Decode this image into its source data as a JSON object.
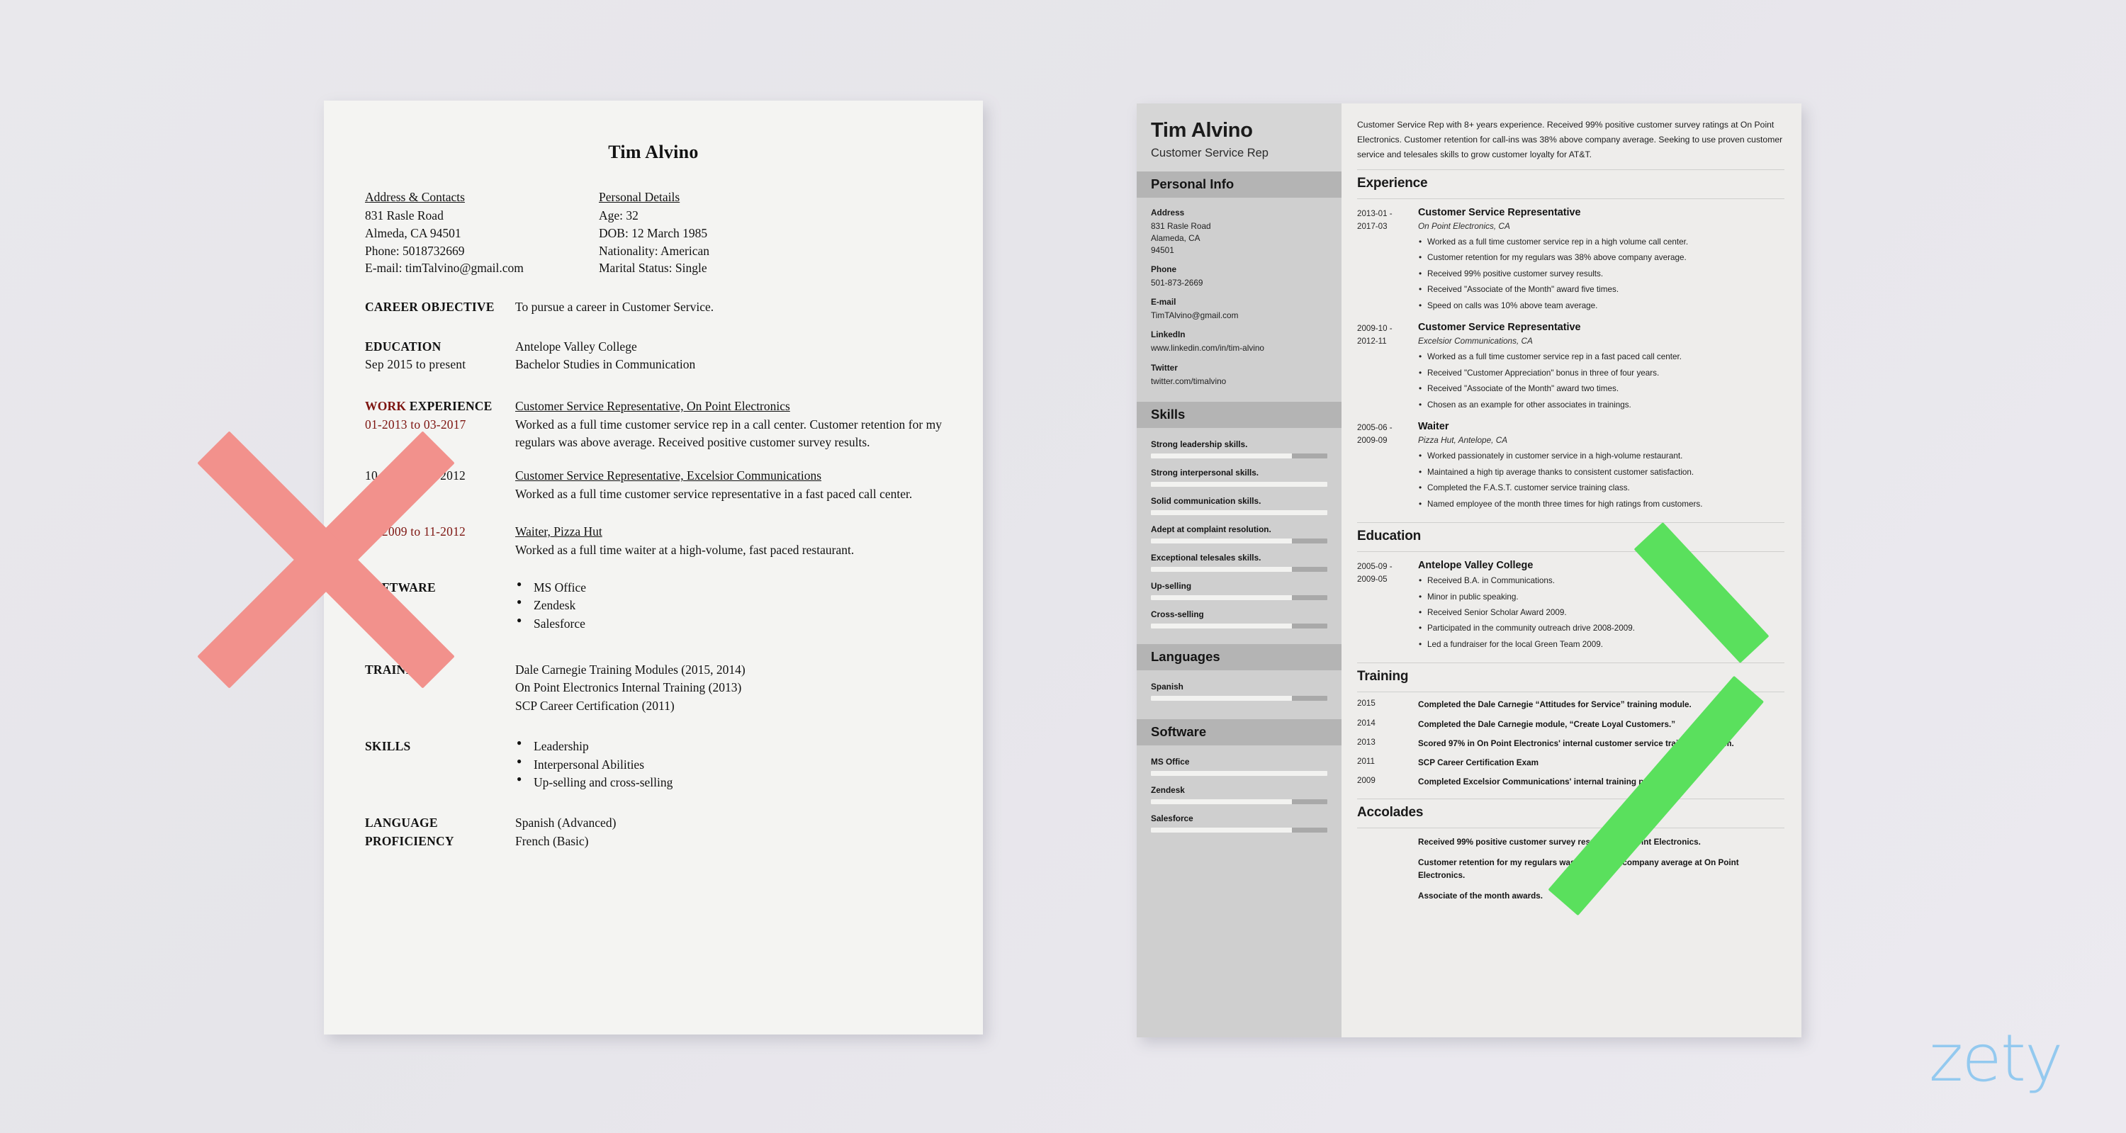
{
  "background_color": "#e8e7ec",
  "bad_resume": {
    "name": "Tim Alvino",
    "contacts": {
      "heading": "Address & Contacts",
      "line1": "831 Rasle Road",
      "line2": "Almeda, CA 94501",
      "line3": "Phone: 5018732669",
      "line4": "E-mail: timTalvino@gmail.com"
    },
    "personal": {
      "heading": "Personal Details",
      "line1": "Age:    32",
      "line2": "DOB:   12 March 1985",
      "line3": "Nationality: American",
      "line4": "Marital Status: Single"
    },
    "career_objective": {
      "label": "CAREER OBJECTIVE",
      "text": "To pursue a career in Customer Service."
    },
    "education": {
      "label": "EDUCATION",
      "sub": "Sep 2015 to present",
      "line1": "Antelope Valley College",
      "line2": "Bachelor Studies in Communication"
    },
    "work_experience": {
      "label_red": "WORK",
      "label_rest": " EXPERIENCE",
      "jobs": [
        {
          "dates": "01-2013 to 03-2017",
          "title": "Customer Service Representative, On Point Electronics",
          "desc": "Worked as a full time customer service rep in a call center. Customer retention for my regulars was above average. Received positive customer survey results."
        },
        {
          "dates": "10-2009 to 11-2012",
          "title": "Customer Service Representative, Excelsior Communications",
          "desc": "Worked as a full time customer service representative in a fast paced call center."
        },
        {
          "dates": "10-2009 to 11-2012",
          "title": "Waiter, Pizza Hut",
          "desc": "Worked as a full time waiter at a high-volume, fast paced restaurant."
        }
      ]
    },
    "software": {
      "label": "SOFTWARE",
      "items": [
        "MS Office",
        "Zendesk",
        "Salesforce"
      ]
    },
    "training": {
      "label": "TRAINING",
      "lines": [
        "Dale Carnegie Training Modules (2015, 2014)",
        "On Point Electronics Internal Training (2013)",
        "SCP Career Certification (2011)"
      ]
    },
    "skills": {
      "label": "SKILLS",
      "items": [
        "Leadership",
        "Interpersonal Abilities",
        "Up-selling and cross-selling"
      ]
    },
    "language": {
      "label_l1": "LANGUAGE",
      "label_l2": "PROFICIENCY",
      "lines": [
        "Spanish (Advanced)",
        "French (Basic)"
      ]
    }
  },
  "good_resume": {
    "sidebar": {
      "name": "Tim Alvino",
      "role": "Customer Service Rep",
      "personal_info_heading": "Personal Info",
      "fields": [
        {
          "label": "Address",
          "value": "831 Rasle Road\nAlameda, CA\n94501"
        },
        {
          "label": "Phone",
          "value": "501-873-2669"
        },
        {
          "label": "E-mail",
          "value": "TimTAlvino@gmail.com"
        },
        {
          "label": "LinkedIn",
          "value": "www.linkedin.com/in/tim-alvino"
        },
        {
          "label": "Twitter",
          "value": "twitter.com/timalvino"
        }
      ],
      "skills_heading": "Skills",
      "skills": [
        {
          "name": "Strong leadership skills.",
          "level": 80
        },
        {
          "name": "Strong interpersonal skills.",
          "level": 100
        },
        {
          "name": "Solid communication skills.",
          "level": 100
        },
        {
          "name": "Adept at complaint resolution.",
          "level": 80
        },
        {
          "name": "Exceptional telesales skills.",
          "level": 80
        },
        {
          "name": "Up-selling",
          "level": 80
        },
        {
          "name": "Cross-selling",
          "level": 80
        }
      ],
      "languages_heading": "Languages",
      "languages": [
        {
          "name": "Spanish",
          "level": 80
        }
      ],
      "software_heading": "Software",
      "software": [
        {
          "name": "MS Office",
          "level": 100
        },
        {
          "name": "Zendesk",
          "level": 80
        },
        {
          "name": "Salesforce",
          "level": 80
        }
      ]
    },
    "main": {
      "summary": "Customer Service Rep with 8+ years experience. Received 99% positive customer survey ratings at On Point Electronics. Customer retention for call-ins was 38% above company average. Seeking to use proven customer service and telesales skills to grow customer loyalty for AT&T.",
      "experience_heading": "Experience",
      "experience": [
        {
          "dates": "2013-01 -\n2017-03",
          "title": "Customer Service Representative",
          "org": "On Point Electronics, CA",
          "bullets": [
            "Worked as a full time customer service rep in a high volume call center.",
            "Customer retention for my regulars was 38% above company average.",
            "Received 99% positive customer survey results.",
            "Received \"Associate of the Month\" award five times.",
            "Speed on calls was 10% above team average."
          ]
        },
        {
          "dates": "2009-10 -\n2012-11",
          "title": "Customer Service Representative",
          "org": "Excelsior Communications, CA",
          "bullets": [
            "Worked as a full time customer service rep in a fast paced call center.",
            "Received \"Customer Appreciation\" bonus in three of four years.",
            "Received \"Associate of the Month\" award two times.",
            "Chosen as an example for other associates in trainings."
          ]
        },
        {
          "dates": "2005-06 -\n2009-09",
          "title": "Waiter",
          "org": "Pizza Hut, Antelope, CA",
          "bullets": [
            "Worked passionately in customer service in a high-volume restaurant.",
            "Maintained a high tip average thanks to consistent customer satisfaction.",
            "Completed the F.A.S.T. customer service training class.",
            "Named employee of the month three times for high ratings from customers."
          ]
        }
      ],
      "education_heading": "Education",
      "education": [
        {
          "dates": "2005-09 -\n2009-05",
          "title": "Antelope Valley College",
          "bullets": [
            "Received B.A. in Communications.",
            "Minor in public speaking.",
            "Received Senior Scholar Award 2009.",
            "Participated in the community outreach drive 2008-2009.",
            "Led a fundraiser for the local Green Team 2009."
          ]
        }
      ],
      "training_heading": "Training",
      "training": [
        {
          "year": "2015",
          "text": "Completed the Dale Carnegie “Attitudes for Service” training module."
        },
        {
          "year": "2014",
          "text": "Completed the Dale Carnegie module, “Create Loyal Customers.”"
        },
        {
          "year": "2013",
          "text": "Scored 97% in On Point Electronics' internal customer service training program."
        },
        {
          "year": "2011",
          "text": "SCP Career Certification Exam"
        },
        {
          "year": "2009",
          "text": "Completed Excelsior Communications' internal training program."
        }
      ],
      "accolades_heading": "Accolades",
      "accolades": [
        "Received 99% positive customer survey results at On Point Electronics.",
        "Customer retention for my regulars was 38% above company average at On Point Electronics.",
        "Associate of the month awards."
      ]
    }
  },
  "marks": {
    "reject_icon": "x-mark",
    "reject_color": "#f2918c",
    "approve_icon": "check-mark",
    "approve_color": "#5ae05d"
  },
  "logo": {
    "text": "zety",
    "color": "#93c9ef"
  }
}
